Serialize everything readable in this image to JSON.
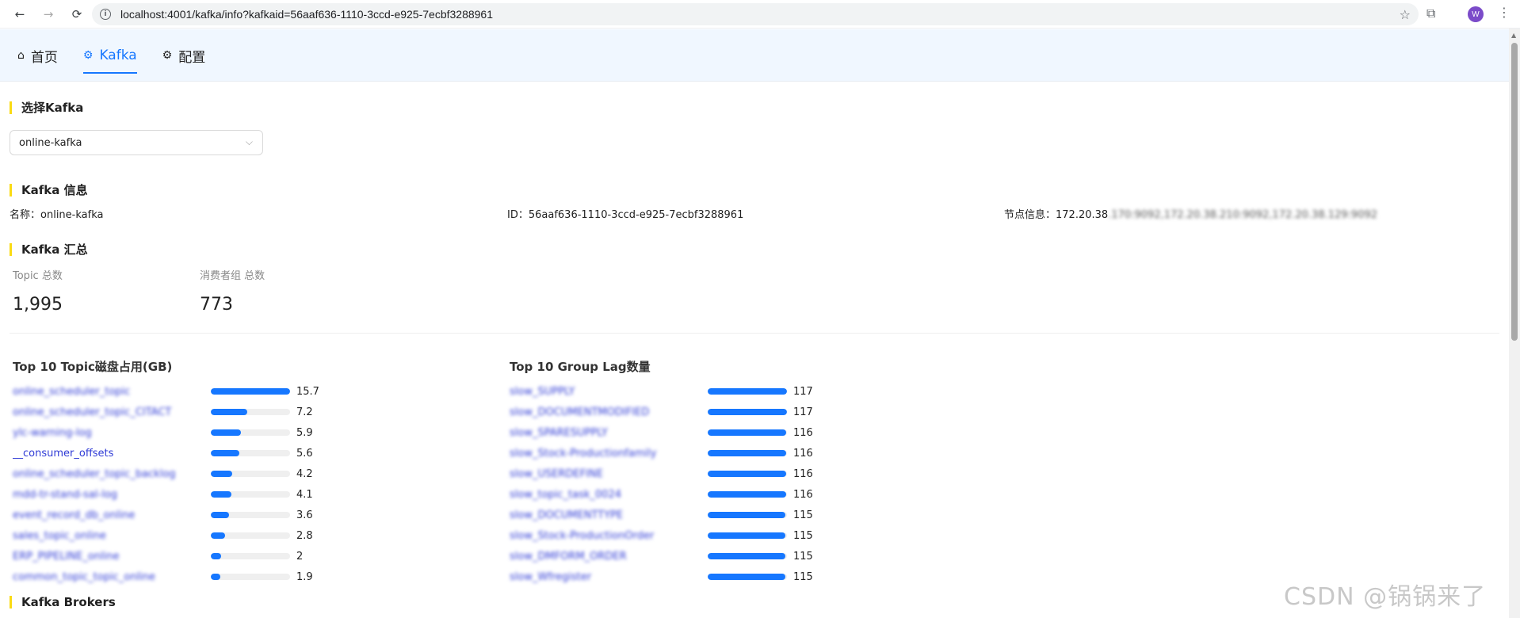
{
  "browser": {
    "url": "localhost:4001/kafka/info?kafkaid=56aaf636-1110-3ccd-e925-7ecbf3288961",
    "avatar_letter": "W"
  },
  "nav": [
    {
      "label": "首页",
      "icon": "home-icon"
    },
    {
      "label": "Kafka",
      "icon": "gear-icon",
      "active": true
    },
    {
      "label": "配置",
      "icon": "gear-icon"
    }
  ],
  "select_section": {
    "title": "选择Kafka",
    "selected": "online-kafka"
  },
  "info_section": {
    "title": "Kafka 信息",
    "name_label": "名称：",
    "name_value": "online-kafka",
    "id_label": "ID：",
    "id_value": "56aaf636-1110-3ccd-e925-7ecbf3288961",
    "nodes_label": "节点信息：",
    "nodes_value": "172.20.38",
    "nodes_blurred": ".170:9092,172.20.38.210:9092,172.20.38.129:9092"
  },
  "summary_section": {
    "title": "Kafka 汇总",
    "topic_label": "Topic 总数",
    "topic_value": "1,995",
    "group_label": "消费者组 总数",
    "group_value": "773"
  },
  "topic_disk": {
    "title": "Top 10 Topic磁盘占用(GB)",
    "max": 15.7,
    "items": [
      {
        "name": "online_scheduler_topic",
        "value": 15.7,
        "label": "15.7",
        "blurred": true
      },
      {
        "name": "online_scheduler_topic_CITACT",
        "value": 7.2,
        "label": "7.2",
        "blurred": true
      },
      {
        "name": "ylc-warning-log",
        "value": 5.9,
        "label": "5.9",
        "blurred": true
      },
      {
        "name": "__consumer_offsets",
        "value": 5.6,
        "label": "5.6",
        "blurred": false
      },
      {
        "name": "online_scheduler_topic_backlog",
        "value": 4.2,
        "label": "4.2",
        "blurred": true
      },
      {
        "name": "mdd-tr-stand-sal-log",
        "value": 4.1,
        "label": "4.1",
        "blurred": true
      },
      {
        "name": "event_record_db_online",
        "value": 3.6,
        "label": "3.6",
        "blurred": true
      },
      {
        "name": "sales_topic_online",
        "value": 2.8,
        "label": "2.8",
        "blurred": true
      },
      {
        "name": "ERP_PIPELINE_online",
        "value": 2,
        "label": "2",
        "blurred": true
      },
      {
        "name": "common_topic_topic_online",
        "value": 1.9,
        "label": "1.9",
        "blurred": true
      }
    ]
  },
  "group_lag": {
    "title": "Top 10 Group Lag数量",
    "max": 117,
    "items": [
      {
        "name": "slow_SUPPLY",
        "value": 117,
        "label": "117",
        "blurred": true
      },
      {
        "name": "slow_DOCUMENTMODIFIED",
        "value": 117,
        "label": "117",
        "blurred": true
      },
      {
        "name": "slow_SPARESUPPLY",
        "value": 116,
        "label": "116",
        "blurred": true
      },
      {
        "name": "slow_Stock-Productionfamily",
        "value": 116,
        "label": "116",
        "blurred": true
      },
      {
        "name": "slow_USERDEFINE",
        "value": 116,
        "label": "116",
        "blurred": true
      },
      {
        "name": "slow_topic_task_0024",
        "value": 116,
        "label": "116",
        "blurred": true
      },
      {
        "name": "slow_DOCUMENTTYPE",
        "value": 115,
        "label": "115",
        "blurred": true
      },
      {
        "name": "slow_Stock-ProductionOrder",
        "value": 115,
        "label": "115",
        "blurred": true
      },
      {
        "name": "slow_DMFORM_ORDER",
        "value": 115,
        "label": "115",
        "blurred": true
      },
      {
        "name": "slow_Wfregister",
        "value": 115,
        "label": "115",
        "blurred": true
      }
    ]
  },
  "brokers_section": {
    "title": "Kafka Brokers"
  },
  "watermark": "CSDN @锅锅来了",
  "colors": {
    "accent": "#1677ff",
    "section_marker": "#fadb14",
    "header_bg": "#f0f7ff"
  }
}
